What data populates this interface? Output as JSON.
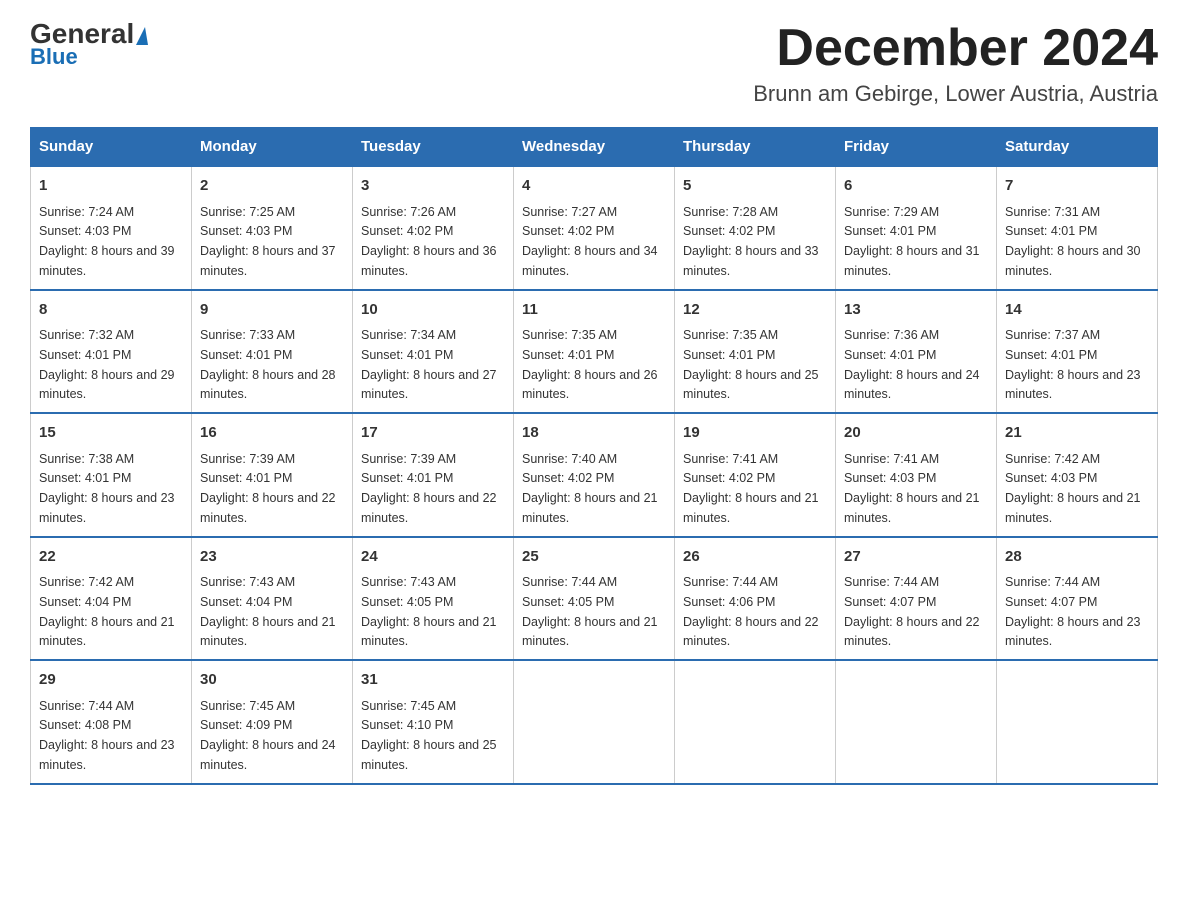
{
  "header": {
    "logo_general": "General",
    "logo_blue": "Blue",
    "month_title": "December 2024",
    "location": "Brunn am Gebirge, Lower Austria, Austria"
  },
  "days_of_week": [
    "Sunday",
    "Monday",
    "Tuesday",
    "Wednesday",
    "Thursday",
    "Friday",
    "Saturday"
  ],
  "weeks": [
    [
      {
        "day": "1",
        "sunrise": "7:24 AM",
        "sunset": "4:03 PM",
        "daylight": "8 hours and 39 minutes."
      },
      {
        "day": "2",
        "sunrise": "7:25 AM",
        "sunset": "4:03 PM",
        "daylight": "8 hours and 37 minutes."
      },
      {
        "day": "3",
        "sunrise": "7:26 AM",
        "sunset": "4:02 PM",
        "daylight": "8 hours and 36 minutes."
      },
      {
        "day": "4",
        "sunrise": "7:27 AM",
        "sunset": "4:02 PM",
        "daylight": "8 hours and 34 minutes."
      },
      {
        "day": "5",
        "sunrise": "7:28 AM",
        "sunset": "4:02 PM",
        "daylight": "8 hours and 33 minutes."
      },
      {
        "day": "6",
        "sunrise": "7:29 AM",
        "sunset": "4:01 PM",
        "daylight": "8 hours and 31 minutes."
      },
      {
        "day": "7",
        "sunrise": "7:31 AM",
        "sunset": "4:01 PM",
        "daylight": "8 hours and 30 minutes."
      }
    ],
    [
      {
        "day": "8",
        "sunrise": "7:32 AM",
        "sunset": "4:01 PM",
        "daylight": "8 hours and 29 minutes."
      },
      {
        "day": "9",
        "sunrise": "7:33 AM",
        "sunset": "4:01 PM",
        "daylight": "8 hours and 28 minutes."
      },
      {
        "day": "10",
        "sunrise": "7:34 AM",
        "sunset": "4:01 PM",
        "daylight": "8 hours and 27 minutes."
      },
      {
        "day": "11",
        "sunrise": "7:35 AM",
        "sunset": "4:01 PM",
        "daylight": "8 hours and 26 minutes."
      },
      {
        "day": "12",
        "sunrise": "7:35 AM",
        "sunset": "4:01 PM",
        "daylight": "8 hours and 25 minutes."
      },
      {
        "day": "13",
        "sunrise": "7:36 AM",
        "sunset": "4:01 PM",
        "daylight": "8 hours and 24 minutes."
      },
      {
        "day": "14",
        "sunrise": "7:37 AM",
        "sunset": "4:01 PM",
        "daylight": "8 hours and 23 minutes."
      }
    ],
    [
      {
        "day": "15",
        "sunrise": "7:38 AM",
        "sunset": "4:01 PM",
        "daylight": "8 hours and 23 minutes."
      },
      {
        "day": "16",
        "sunrise": "7:39 AM",
        "sunset": "4:01 PM",
        "daylight": "8 hours and 22 minutes."
      },
      {
        "day": "17",
        "sunrise": "7:39 AM",
        "sunset": "4:01 PM",
        "daylight": "8 hours and 22 minutes."
      },
      {
        "day": "18",
        "sunrise": "7:40 AM",
        "sunset": "4:02 PM",
        "daylight": "8 hours and 21 minutes."
      },
      {
        "day": "19",
        "sunrise": "7:41 AM",
        "sunset": "4:02 PM",
        "daylight": "8 hours and 21 minutes."
      },
      {
        "day": "20",
        "sunrise": "7:41 AM",
        "sunset": "4:03 PM",
        "daylight": "8 hours and 21 minutes."
      },
      {
        "day": "21",
        "sunrise": "7:42 AM",
        "sunset": "4:03 PM",
        "daylight": "8 hours and 21 minutes."
      }
    ],
    [
      {
        "day": "22",
        "sunrise": "7:42 AM",
        "sunset": "4:04 PM",
        "daylight": "8 hours and 21 minutes."
      },
      {
        "day": "23",
        "sunrise": "7:43 AM",
        "sunset": "4:04 PM",
        "daylight": "8 hours and 21 minutes."
      },
      {
        "day": "24",
        "sunrise": "7:43 AM",
        "sunset": "4:05 PM",
        "daylight": "8 hours and 21 minutes."
      },
      {
        "day": "25",
        "sunrise": "7:44 AM",
        "sunset": "4:05 PM",
        "daylight": "8 hours and 21 minutes."
      },
      {
        "day": "26",
        "sunrise": "7:44 AM",
        "sunset": "4:06 PM",
        "daylight": "8 hours and 22 minutes."
      },
      {
        "day": "27",
        "sunrise": "7:44 AM",
        "sunset": "4:07 PM",
        "daylight": "8 hours and 22 minutes."
      },
      {
        "day": "28",
        "sunrise": "7:44 AM",
        "sunset": "4:07 PM",
        "daylight": "8 hours and 23 minutes."
      }
    ],
    [
      {
        "day": "29",
        "sunrise": "7:44 AM",
        "sunset": "4:08 PM",
        "daylight": "8 hours and 23 minutes."
      },
      {
        "day": "30",
        "sunrise": "7:45 AM",
        "sunset": "4:09 PM",
        "daylight": "8 hours and 24 minutes."
      },
      {
        "day": "31",
        "sunrise": "7:45 AM",
        "sunset": "4:10 PM",
        "daylight": "8 hours and 25 minutes."
      },
      {
        "day": "",
        "sunrise": "",
        "sunset": "",
        "daylight": ""
      },
      {
        "day": "",
        "sunrise": "",
        "sunset": "",
        "daylight": ""
      },
      {
        "day": "",
        "sunrise": "",
        "sunset": "",
        "daylight": ""
      },
      {
        "day": "",
        "sunrise": "",
        "sunset": "",
        "daylight": ""
      }
    ]
  ],
  "labels": {
    "sunrise": "Sunrise: ",
    "sunset": "Sunset: ",
    "daylight": "Daylight: "
  }
}
